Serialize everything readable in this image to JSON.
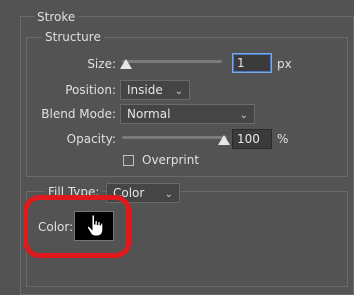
{
  "stroke": {
    "title": "Stroke",
    "structure": {
      "title": "Structure",
      "size": {
        "label": "Size:",
        "value": "1",
        "unit": "px",
        "slider_fraction": 0.02
      },
      "position": {
        "label": "Position:",
        "selected": "Inside"
      },
      "blend_mode": {
        "label": "Blend Mode:",
        "selected": "Normal"
      },
      "opacity": {
        "label": "Opacity:",
        "value": "100",
        "unit": "%",
        "slider_fraction": 1.0
      },
      "overprint": {
        "label": "Overprint",
        "checked": false
      }
    },
    "fill": {
      "type_label": "Fill Type:",
      "type_selected": "Color",
      "color_label": "Color:",
      "color_value": "#000000",
      "highlight_color": "#e0191d"
    },
    "cursor_icon": "hand-pointer-icon"
  }
}
